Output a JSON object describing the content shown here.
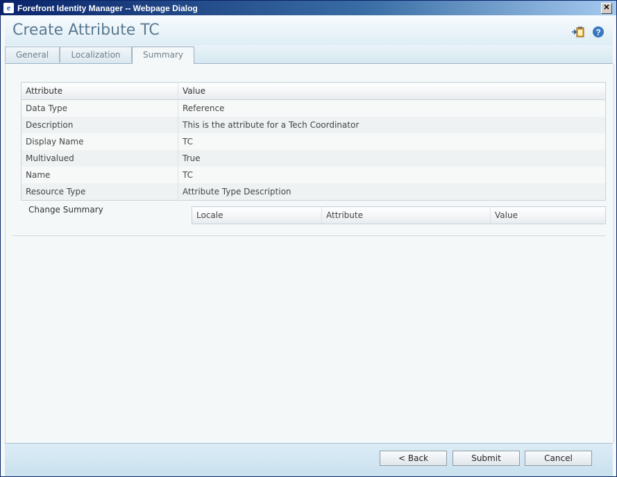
{
  "window": {
    "title": "Forefront Identity Manager -- Webpage Dialog",
    "close_glyph": "✕"
  },
  "header": {
    "page_title": "Create Attribute TC",
    "icons": [
      "add-to-clipboard-icon",
      "help-icon"
    ]
  },
  "tabs": [
    {
      "label": "General",
      "active": false
    },
    {
      "label": "Localization",
      "active": false
    },
    {
      "label": "Summary",
      "active": true
    }
  ],
  "summary_table": {
    "columns": [
      "Attribute",
      "Value"
    ],
    "rows": [
      {
        "attribute": "Data Type",
        "value": "Reference"
      },
      {
        "attribute": "Description",
        "value": "This is the attribute for a Tech Coordinator"
      },
      {
        "attribute": "Display Name",
        "value": "TC"
      },
      {
        "attribute": "Multivalued",
        "value": "True"
      },
      {
        "attribute": "Name",
        "value": "TC"
      },
      {
        "attribute": "Resource Type",
        "value": "Attribute Type Description"
      }
    ]
  },
  "change_summary": {
    "label": "Change Summary",
    "columns": [
      "Locale",
      "Attribute",
      "Value"
    ]
  },
  "footer": {
    "back_label": "< Back",
    "submit_label": "Submit",
    "cancel_label": "Cancel"
  },
  "colors": {
    "titlebar": "#0a246a",
    "page_title": "#5a7a92",
    "accent": "#3a78c2"
  }
}
